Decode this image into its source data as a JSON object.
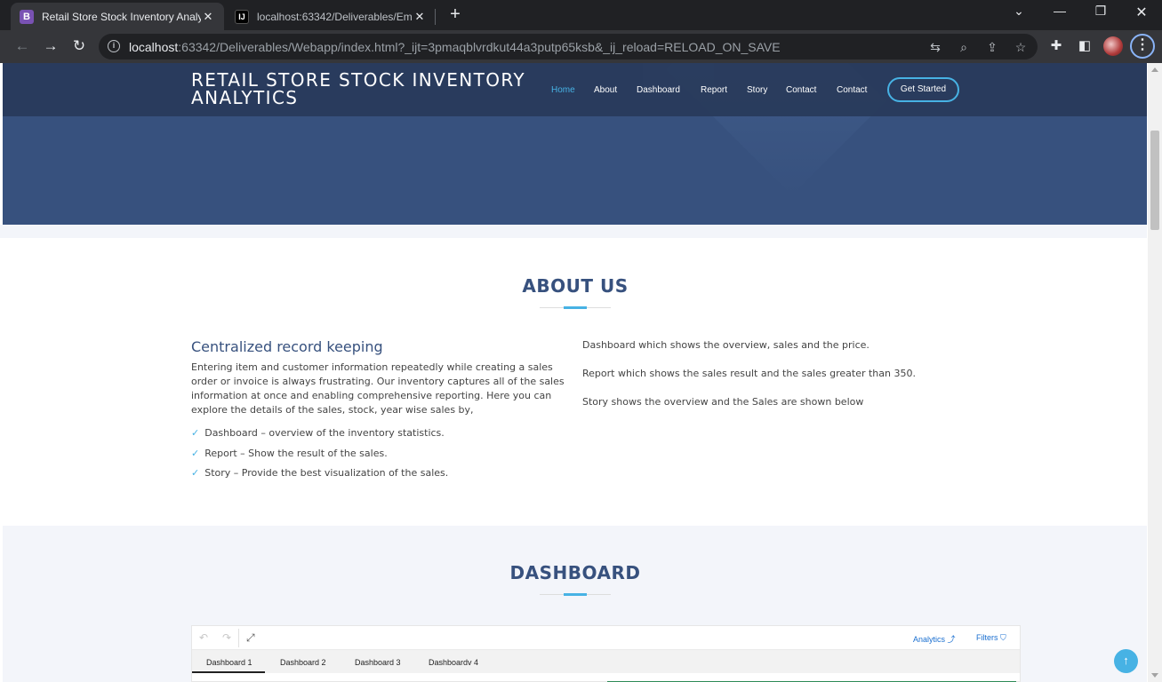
{
  "browser": {
    "tabs": [
      {
        "title": "Retail Store Stock Inventory Analy",
        "favicon": "B",
        "active": true
      },
      {
        "title": "localhost:63342/Deliverables/Em",
        "favicon": "IJ",
        "active": false
      }
    ],
    "url_host": "localhost",
    "url_path": ":63342/Deliverables/Webapp/index.html?_ijt=3pmaqblvrdkut44a3putp65ksb&_ij_reload=RELOAD_ON_SAVE"
  },
  "header": {
    "logo_line1": "Retail Store Stock Inventory",
    "logo_line2": "Analytics",
    "nav": [
      "Home",
      "About",
      "Dashboard",
      "Report",
      "Story",
      "Contact",
      "Contact"
    ],
    "cta": "Get Started"
  },
  "about": {
    "title": "ABOUT US",
    "heading": "Centralized record keeping",
    "paragraph": "Entering item and customer information repeatedly while creating a sales order or invoice is always frustrating. Our inventory captures all of the sales information at once and enabling comprehensive reporting. Here you can explore the details of the sales, stock, year wise sales by,",
    "list": [
      "Dashboard – overview of the inventory statistics.",
      "Report – Show the result of the sales.",
      "Story – Provide the best visualization of the sales."
    ],
    "right": [
      "Dashboard which shows the overview, sales and the price.",
      "Report which shows the sales result and the sales greater than 350.",
      "Story shows the overview and the Sales are shown below"
    ]
  },
  "dashboard": {
    "title": "DASHBOARD",
    "analytics_label": "Analytics",
    "filters_label": "Filters",
    "tabs": [
      "Dashboard 1",
      "Dashboard 2",
      "Dashboard 3",
      "Dashboardv 4"
    ]
  },
  "colors": {
    "brand": "#37517e",
    "accent": "#47b2e4",
    "section_bg": "#f3f5fa"
  }
}
